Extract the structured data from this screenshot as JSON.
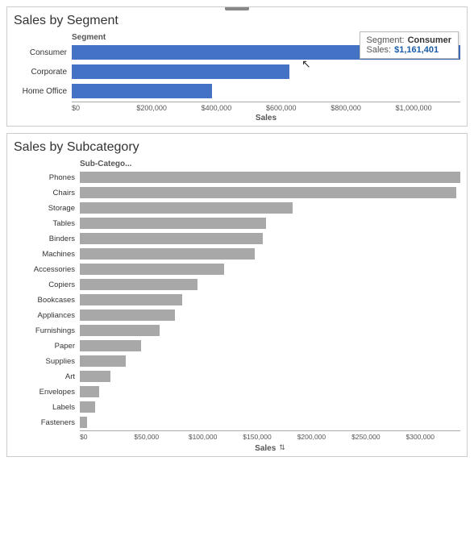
{
  "section1": {
    "title": "Sales by Segment",
    "yAxisLabel": "Segment",
    "xAxisLabel": "Sales",
    "tooltip": {
      "segment_label": "Segment:",
      "segment_value": "Consumer",
      "sales_label": "Sales:",
      "sales_value": "$1,161,401"
    },
    "bars": [
      {
        "label": "Consumer",
        "pct": 100,
        "type": "blue"
      },
      {
        "label": "Corporate",
        "pct": 56,
        "type": "blue"
      },
      {
        "label": "Home Office",
        "pct": 36,
        "type": "blue"
      }
    ],
    "xTicks": [
      "$0",
      "$200,000",
      "$400,000",
      "$600,000",
      "$800,000",
      "$1,000,000"
    ]
  },
  "section2": {
    "title": "Sales by Subcategory",
    "yAxisLabel": "Sub-Catego...",
    "xAxisLabel": "Sales",
    "bars": [
      {
        "label": "Phones",
        "pct": 100,
        "type": "gray"
      },
      {
        "label": "Chairs",
        "pct": 99,
        "type": "gray"
      },
      {
        "label": "Storage",
        "pct": 56,
        "type": "gray"
      },
      {
        "label": "Tables",
        "pct": 49,
        "type": "gray"
      },
      {
        "label": "Binders",
        "pct": 48,
        "type": "gray"
      },
      {
        "label": "Machines",
        "pct": 46,
        "type": "gray"
      },
      {
        "label": "Accessories",
        "pct": 38,
        "type": "gray"
      },
      {
        "label": "Copiers",
        "pct": 31,
        "type": "gray"
      },
      {
        "label": "Bookcases",
        "pct": 27,
        "type": "gray"
      },
      {
        "label": "Appliances",
        "pct": 25,
        "type": "gray"
      },
      {
        "label": "Furnishings",
        "pct": 21,
        "type": "gray"
      },
      {
        "label": "Paper",
        "pct": 16,
        "type": "gray"
      },
      {
        "label": "Supplies",
        "pct": 12,
        "type": "gray"
      },
      {
        "label": "Art",
        "pct": 8,
        "type": "gray"
      },
      {
        "label": "Envelopes",
        "pct": 5,
        "type": "gray"
      },
      {
        "label": "Labels",
        "pct": 4,
        "type": "gray"
      },
      {
        "label": "Fasteners",
        "pct": 2,
        "type": "gray"
      }
    ],
    "xTicks": [
      "$0",
      "$50,000",
      "$100,000",
      "$150,000",
      "$200,000",
      "$250,000",
      "$300,000"
    ]
  }
}
